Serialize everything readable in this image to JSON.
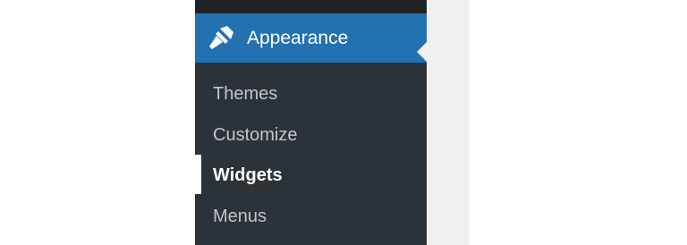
{
  "menu": {
    "active": {
      "label": "Appearance",
      "icon": "paintbrush-icon"
    },
    "submenu": [
      {
        "label": "Themes",
        "current": false
      },
      {
        "label": "Customize",
        "current": false
      },
      {
        "label": "Widgets",
        "current": true
      },
      {
        "label": "Menus",
        "current": false
      }
    ]
  },
  "colors": {
    "sidebar_bg": "#2c3338",
    "active_bg": "#2271b1",
    "content_bg": "#f0f0f1",
    "submenu_text": "#c3c4c7",
    "current_text": "#ffffff"
  }
}
